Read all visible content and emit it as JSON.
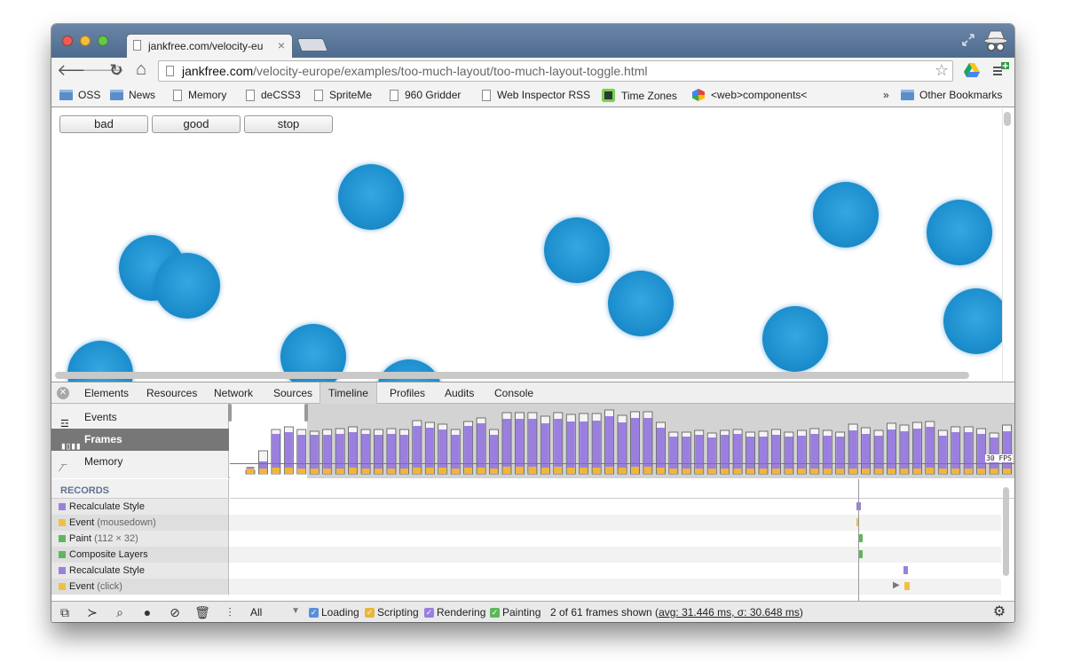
{
  "browser": {
    "tab_title": "jankfree.com/velocity-euro",
    "tab_close": "×",
    "url_host": "jankfree.com",
    "url_path": "/velocity-europe/examples/too-much-layout/too-much-layout-toggle.html",
    "back_icon": "🡐",
    "forward_icon": "🡒",
    "reload_icon": "↻",
    "home_icon": "⌂",
    "star_icon": "☆",
    "bookmarks": [
      {
        "label": "OSS",
        "type": "folder"
      },
      {
        "label": "News",
        "type": "folder"
      },
      {
        "label": "Memory",
        "type": "page"
      },
      {
        "label": "deCSS3",
        "type": "page"
      },
      {
        "label": "SpriteMe",
        "type": "page"
      },
      {
        "label": "960 Gridder",
        "type": "page"
      },
      {
        "label": "Web Inspector RSS",
        "type": "page"
      },
      {
        "label": "Time Zones",
        "type": "app"
      },
      {
        "label": "<web>components<",
        "type": "app"
      }
    ],
    "bookmarks_more": "»",
    "other_bookmarks": "Other Bookmarks"
  },
  "page": {
    "buttons": [
      "bad",
      "good",
      "stop"
    ],
    "ball_color": "#1d8fce"
  },
  "devtools": {
    "tabs": [
      "Elements",
      "Resources",
      "Network",
      "Sources",
      "Timeline",
      "Profiles",
      "Audits",
      "Console"
    ],
    "active_tab": "Timeline",
    "overview_items": [
      "Events",
      "Frames",
      "Memory"
    ],
    "overview_selected": "Frames",
    "fps_label": "30 FPS",
    "records_header": "RECORDS",
    "records": [
      {
        "label": "Recalculate Style",
        "detail": "",
        "color": "#9b7fe0"
      },
      {
        "label": "Event",
        "detail": "(mousedown)",
        "color": "#f0c040"
      },
      {
        "label": "Paint",
        "detail": "(112 × 32)",
        "color": "#5cb85c"
      },
      {
        "label": "Composite Layers",
        "detail": "",
        "color": "#5cb85c"
      },
      {
        "label": "Recalculate Style",
        "detail": "",
        "color": "#9b7fe0"
      },
      {
        "label": "Event",
        "detail": "(click)",
        "color": "#f0c040"
      }
    ],
    "filter_value": "All",
    "categories": [
      {
        "label": "Loading",
        "color": "#5b8fd8"
      },
      {
        "label": "Scripting",
        "color": "#e8b73a"
      },
      {
        "label": "Rendering",
        "color": "#9b7fe0"
      },
      {
        "label": "Painting",
        "color": "#5cb85c"
      }
    ],
    "stats_prefix": "2 of 61 frames shown (",
    "stats_avg": "avg: 31.446 ms, σ: 30.648 ms",
    "stats_suffix": ")",
    "frames": [
      {
        "script": 6,
        "render": 2,
        "total": 4
      },
      {
        "script": 6,
        "render": 8,
        "total": 26
      },
      {
        "script": 7,
        "render": 38,
        "total": 50
      },
      {
        "script": 7,
        "render": 40,
        "total": 53
      },
      {
        "script": 6,
        "render": 38,
        "total": 50
      },
      {
        "script": 6,
        "render": 38,
        "total": 48
      },
      {
        "script": 6,
        "render": 38,
        "total": 50
      },
      {
        "script": 6,
        "render": 39,
        "total": 51
      },
      {
        "script": 7,
        "render": 40,
        "total": 53
      },
      {
        "script": 6,
        "render": 39,
        "total": 50
      },
      {
        "script": 6,
        "render": 38,
        "total": 50
      },
      {
        "script": 6,
        "render": 39,
        "total": 51
      },
      {
        "script": 6,
        "render": 38,
        "total": 50
      },
      {
        "script": 7,
        "render": 47,
        "total": 60
      },
      {
        "script": 7,
        "render": 45,
        "total": 58
      },
      {
        "script": 7,
        "render": 43,
        "total": 56
      },
      {
        "script": 6,
        "render": 38,
        "total": 50
      },
      {
        "script": 7,
        "render": 47,
        "total": 59
      },
      {
        "script": 7,
        "render": 50,
        "total": 63
      },
      {
        "script": 6,
        "render": 38,
        "total": 50
      },
      {
        "script": 8,
        "render": 54,
        "total": 69
      },
      {
        "script": 8,
        "render": 54,
        "total": 69
      },
      {
        "script": 8,
        "render": 54,
        "total": 69
      },
      {
        "script": 7,
        "render": 50,
        "total": 65
      },
      {
        "script": 8,
        "render": 54,
        "total": 69
      },
      {
        "script": 7,
        "render": 52,
        "total": 67
      },
      {
        "script": 7,
        "render": 52,
        "total": 68
      },
      {
        "script": 7,
        "render": 53,
        "total": 68
      },
      {
        "script": 8,
        "render": 57,
        "total": 72
      },
      {
        "script": 7,
        "render": 51,
        "total": 66
      },
      {
        "script": 8,
        "render": 55,
        "total": 70
      },
      {
        "script": 8,
        "render": 55,
        "total": 70
      },
      {
        "script": 7,
        "render": 45,
        "total": 58
      },
      {
        "script": 6,
        "render": 36,
        "total": 47
      },
      {
        "script": 6,
        "render": 36,
        "total": 47
      },
      {
        "script": 6,
        "render": 38,
        "total": 49
      },
      {
        "script": 6,
        "render": 35,
        "total": 46
      },
      {
        "script": 6,
        "render": 38,
        "total": 49
      },
      {
        "script": 6,
        "render": 39,
        "total": 50
      },
      {
        "script": 6,
        "render": 36,
        "total": 47
      },
      {
        "script": 6,
        "render": 36,
        "total": 48
      },
      {
        "script": 6,
        "render": 38,
        "total": 50
      },
      {
        "script": 6,
        "render": 36,
        "total": 47
      },
      {
        "script": 6,
        "render": 37,
        "total": 49
      },
      {
        "script": 6,
        "render": 39,
        "total": 51
      },
      {
        "script": 6,
        "render": 37,
        "total": 49
      },
      {
        "script": 6,
        "render": 36,
        "total": 47
      },
      {
        "script": 6,
        "render": 43,
        "total": 56
      },
      {
        "script": 6,
        "render": 39,
        "total": 52
      },
      {
        "script": 6,
        "render": 37,
        "total": 49
      },
      {
        "script": 6,
        "render": 44,
        "total": 57
      },
      {
        "script": 6,
        "render": 42,
        "total": 55
      },
      {
        "script": 6,
        "render": 45,
        "total": 58
      },
      {
        "script": 7,
        "render": 46,
        "total": 59
      },
      {
        "script": 6,
        "render": 37,
        "total": 49
      },
      {
        "script": 6,
        "render": 41,
        "total": 53
      },
      {
        "script": 6,
        "render": 41,
        "total": 53
      },
      {
        "script": 6,
        "render": 39,
        "total": 51
      },
      {
        "script": 6,
        "render": 35,
        "total": 46
      },
      {
        "script": 6,
        "render": 42,
        "total": 55
      },
      {
        "script": 6,
        "render": 44,
        "total": 57
      }
    ]
  }
}
